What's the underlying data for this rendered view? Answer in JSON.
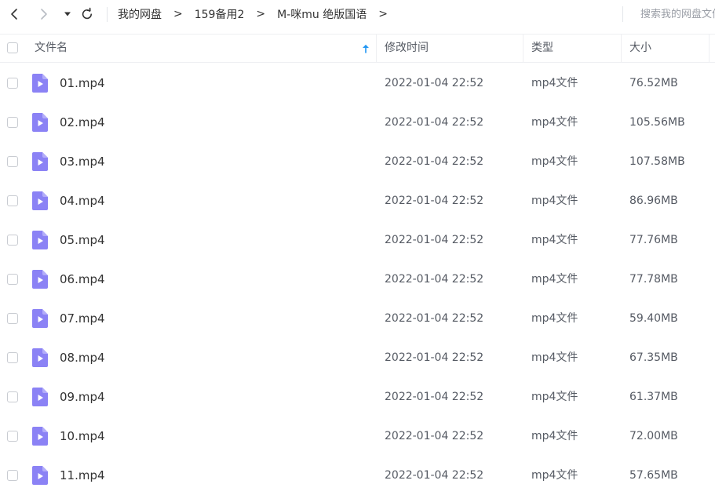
{
  "toolbar": {
    "back_icon": "chevron-left-icon",
    "forward_icon": "chevron-right-icon",
    "history_icon": "caret-down-icon",
    "refresh_icon": "refresh-icon"
  },
  "breadcrumb": [
    {
      "label": "我的网盘"
    },
    {
      "label": "159备用2"
    },
    {
      "label": "M-咪mu 绝版国语"
    }
  ],
  "breadcrumb_separator": ">",
  "search": {
    "placeholder": "搜索我的网盘文件"
  },
  "header": {
    "name": "文件名",
    "modified": "修改时间",
    "type": "类型",
    "size": "大小",
    "sort_icon": "arrow-up-icon"
  },
  "colors": {
    "file_icon": "#8b82f5",
    "sort_arrow": "#2196f3",
    "text": "#333333",
    "divider": "#eeeff2"
  },
  "files": [
    {
      "name": "01.mp4",
      "modified": "2022-01-04 22:52",
      "type": "mp4文件",
      "size": "76.52MB"
    },
    {
      "name": "02.mp4",
      "modified": "2022-01-04 22:52",
      "type": "mp4文件",
      "size": "105.56MB"
    },
    {
      "name": "03.mp4",
      "modified": "2022-01-04 22:52",
      "type": "mp4文件",
      "size": "107.58MB"
    },
    {
      "name": "04.mp4",
      "modified": "2022-01-04 22:52",
      "type": "mp4文件",
      "size": "86.96MB"
    },
    {
      "name": "05.mp4",
      "modified": "2022-01-04 22:52",
      "type": "mp4文件",
      "size": "77.76MB"
    },
    {
      "name": "06.mp4",
      "modified": "2022-01-04 22:52",
      "type": "mp4文件",
      "size": "77.78MB"
    },
    {
      "name": "07.mp4",
      "modified": "2022-01-04 22:52",
      "type": "mp4文件",
      "size": "59.40MB"
    },
    {
      "name": "08.mp4",
      "modified": "2022-01-04 22:52",
      "type": "mp4文件",
      "size": "67.35MB"
    },
    {
      "name": "09.mp4",
      "modified": "2022-01-04 22:52",
      "type": "mp4文件",
      "size": "61.37MB"
    },
    {
      "name": "10.mp4",
      "modified": "2022-01-04 22:52",
      "type": "mp4文件",
      "size": "72.00MB"
    },
    {
      "name": "11.mp4",
      "modified": "2022-01-04 22:52",
      "type": "mp4文件",
      "size": "57.65MB"
    }
  ]
}
